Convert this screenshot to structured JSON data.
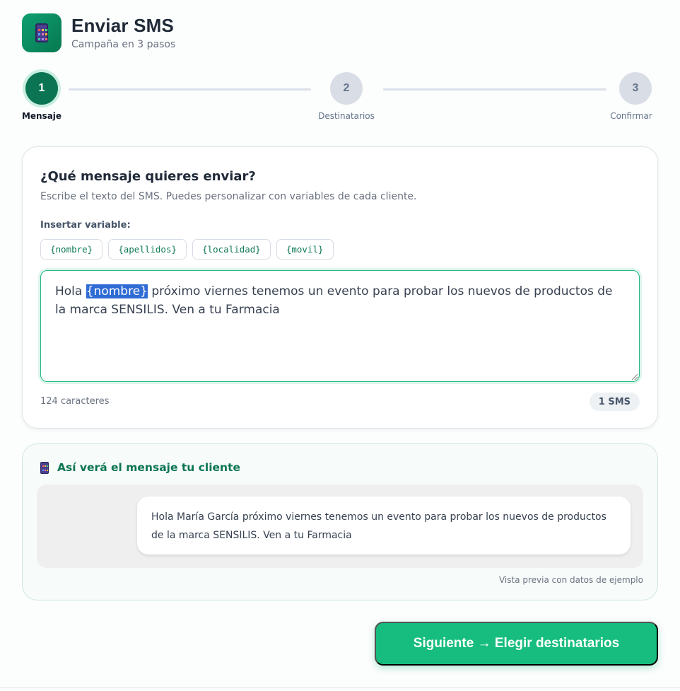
{
  "header": {
    "icon": "phone-icon",
    "title": "Enviar SMS",
    "subtitle": "Campaña en 3 pasos"
  },
  "stepper": {
    "active_step": 1,
    "steps": [
      {
        "number": "1",
        "label": "Mensaje"
      },
      {
        "number": "2",
        "label": "Destinatarios"
      },
      {
        "number": "3",
        "label": "Confirmar"
      }
    ]
  },
  "message_card": {
    "title": "¿Qué mensaje quieres enviar?",
    "description": "Escribe el texto del SMS. Puedes personalizar con variables de cada cliente.",
    "variables_label": "Insertar variable:",
    "variables": [
      "{nombre}",
      "{apellidos}",
      "{localidad}",
      "{movil}"
    ],
    "message_prefix": "Hola ",
    "message_selected": "{nombre}",
    "message_suffix": " próximo viernes tenemos un evento para probar los nuevos de productos de la marca SENSILIS. Ven a tu Farmacia",
    "char_count": "124 caracteres",
    "sms_count": "1 SMS"
  },
  "preview": {
    "icon": "phone-icon",
    "title": "Así verá el mensaje tu cliente",
    "bubble_text": "Hola María García próximo viernes tenemos un evento para probar los nuevos de productos de la marca SENSILIS. Ven a tu Farmacia",
    "note": "Vista previa con datos de ejemplo"
  },
  "actions": {
    "next_label": "Siguiente → Elegir destinatarios"
  },
  "colors": {
    "accent": "#0b7553",
    "button": "#16bd7e",
    "selection": "#2f6bd4"
  }
}
